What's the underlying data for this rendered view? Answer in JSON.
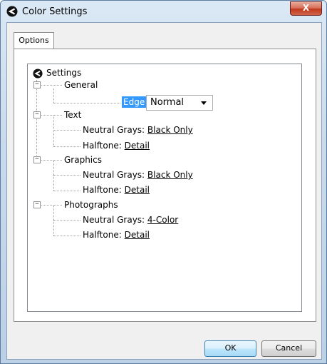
{
  "window": {
    "title": "Color Settings",
    "close_label": "X"
  },
  "tabs": [
    {
      "label": "Options",
      "selected": true
    }
  ],
  "tree": {
    "root_label": "Settings",
    "general": {
      "label": "General",
      "edge_control_label": "Edge Control:",
      "edge_control_value": "Normal"
    },
    "text": {
      "label": "Text",
      "neutral_grays_label": "Neutral Grays:",
      "neutral_grays_value": "Black Only",
      "halftone_label": "Halftone:",
      "halftone_value": "Detail"
    },
    "graphics": {
      "label": "Graphics",
      "neutral_grays_label": "Neutral Grays:",
      "neutral_grays_value": "Black Only",
      "halftone_label": "Halftone:",
      "halftone_value": "Detail"
    },
    "photographs": {
      "label": "Photographs",
      "neutral_grays_label": "Neutral Grays:",
      "neutral_grays_value": "4-Color",
      "halftone_label": "Halftone:",
      "halftone_value": "Detail"
    },
    "expander_symbol": "−"
  },
  "buttons": {
    "ok": "OK",
    "cancel": "Cancel"
  },
  "colors": {
    "selection": "#3399ff",
    "close_button": "#c1381d"
  }
}
